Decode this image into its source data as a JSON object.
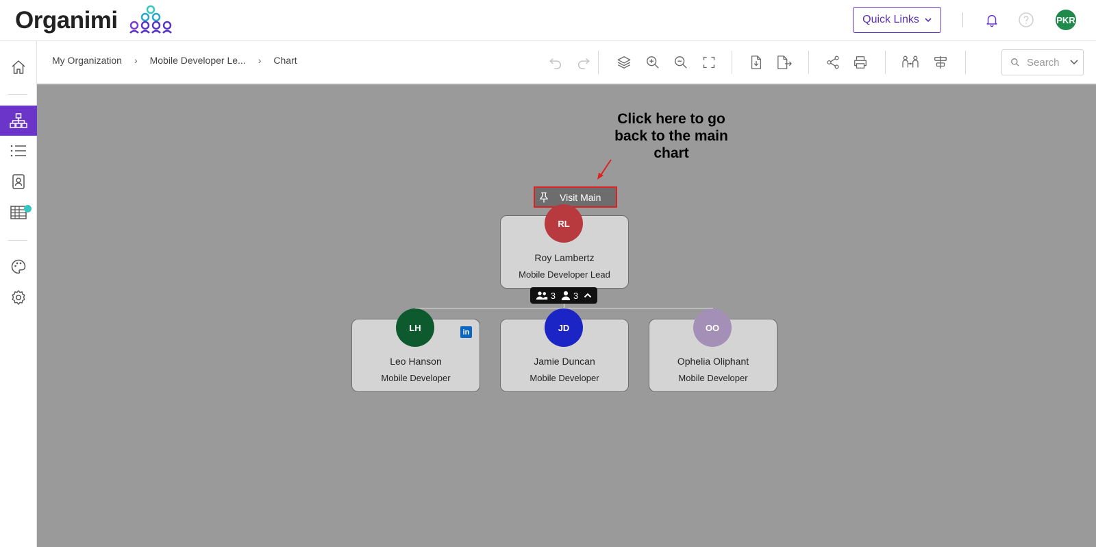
{
  "app": {
    "logo_text": "Organimi",
    "quick_links_label": "Quick Links",
    "user_initials": "PKR"
  },
  "breadcrumb": [
    "My Organization",
    "Mobile Developer Le...",
    "Chart"
  ],
  "toolbar": {
    "search_placeholder": "Search"
  },
  "annotation": {
    "text": "Click here to go back to the main chart"
  },
  "visit_main": {
    "label": "Visit Main"
  },
  "manager": {
    "initials": "RL",
    "name": "Roy Lambertz",
    "role": "Mobile Developer Lead",
    "avatar_color": "#b93a3e",
    "team_count": "3",
    "direct_count": "3"
  },
  "reports": [
    {
      "initials": "LH",
      "name": "Leo Hanson",
      "role": "Mobile Developer",
      "avatar_color": "#0d5a2e",
      "linkedin": "in"
    },
    {
      "initials": "JD",
      "name": "Jamie Duncan",
      "role": "Mobile Developer",
      "avatar_color": "#1b24c4"
    },
    {
      "initials": "OO",
      "name": "Ophelia Oliphant",
      "role": "Mobile Developer",
      "avatar_color": "#a48fb6"
    }
  ],
  "colors": {
    "brand_purple": "#6a35c8",
    "canvas_bg": "#9a9a9a",
    "highlight_red": "#e02020"
  },
  "icons": {
    "sidebar": [
      "home-icon",
      "org-chart-icon",
      "list-icon",
      "directory-icon",
      "table-icon",
      "palette-icon",
      "settings-icon"
    ],
    "toolbar": [
      "undo-icon",
      "redo-icon",
      "layers-icon",
      "zoom-in-icon",
      "zoom-out-icon",
      "fit-screen-icon",
      "import-icon",
      "export-icon",
      "share-icon",
      "print-icon",
      "people-connect-icon",
      "align-icon"
    ]
  }
}
